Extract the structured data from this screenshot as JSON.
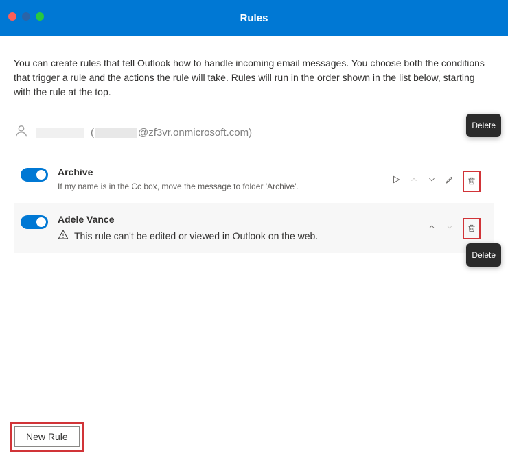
{
  "window": {
    "title": "Rules"
  },
  "intro": "You can create rules that tell Outlook how to handle incoming email messages. You choose both the conditions that trigger a rule and the actions the rule will take. Rules will run in the order shown in the list below, starting with the rule at the top.",
  "account": {
    "domain_suffix": "@zf3vr.onmicrosoft.com)"
  },
  "rules": [
    {
      "name": "Archive",
      "description": "If my name is in the Cc box, move the message to folder 'Archive'.",
      "enabled": true,
      "editable": true
    },
    {
      "name": "Adele Vance",
      "warning": "This rule can't be edited or viewed in Outlook on the web.",
      "enabled": true,
      "editable": false
    }
  ],
  "tooltips": {
    "delete": "Delete"
  },
  "footer": {
    "new_rule_label": "New Rule"
  },
  "icons": {
    "run": "run-icon",
    "up": "chevron-up-icon",
    "down": "chevron-down-icon",
    "edit": "pencil-icon",
    "delete": "trash-icon",
    "warning": "warning-icon",
    "person": "person-icon"
  }
}
